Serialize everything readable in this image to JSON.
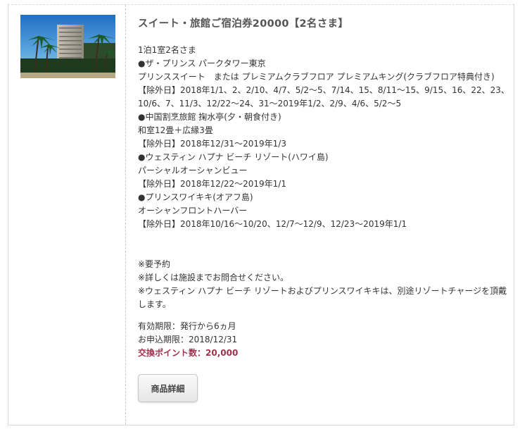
{
  "product": {
    "title": "スイート・旅館ご宿泊券20000【2名さま】",
    "image_alt": "ハワイのリゾートホテルとヤシの木",
    "lines": [
      "1泊1室2名さま",
      "●ザ・プリンス パークタワー東京",
      "プリンススイート　または プレミアムクラブフロア プレミアムキング(クラブフロア特典付き)",
      "【除外日】2018年1/1、2、2/10、4/7、5/2〜5、7/14、15、8/11〜15、9/15、16、22、23、",
      "10/6、7、11/3、12/22〜24、31〜2019年1/2、2/9、4/6、5/2〜5",
      "●中国割烹旅館 掬水亭(夕・朝食付き)",
      "和室12畳＋広縁3畳",
      "【除外日】2018年12/31〜2019年1/3",
      "●ウェスティン ハプナ ビーチ リゾート(ハワイ島)",
      "パーシャルオーシャンビュー",
      "【除外日】2018年12/22〜2019年1/1",
      "●プリンスワイキキ(オアフ島)",
      "オーシャンフロントハーバー",
      "【除外日】2018年10/16〜10/20、12/7〜12/9、12/23〜2019年1/1"
    ],
    "notes": [
      "※要予約",
      "※詳しくは施設までお問合せください。",
      "※ウェスティン ハプナ ビーチ リゾートおよびプリンスワイキキは、別途リゾートチャージを頂戴します。"
    ],
    "validity": "有効期限：発行から6ヵ月",
    "deadline": "お申込期限：2018/12/31",
    "points": "交換ポイント数：20,000",
    "detail_button": "商品詳細"
  },
  "colors": {
    "points": "#a2314d",
    "title": "#555555",
    "border": "#d9d9d9"
  }
}
